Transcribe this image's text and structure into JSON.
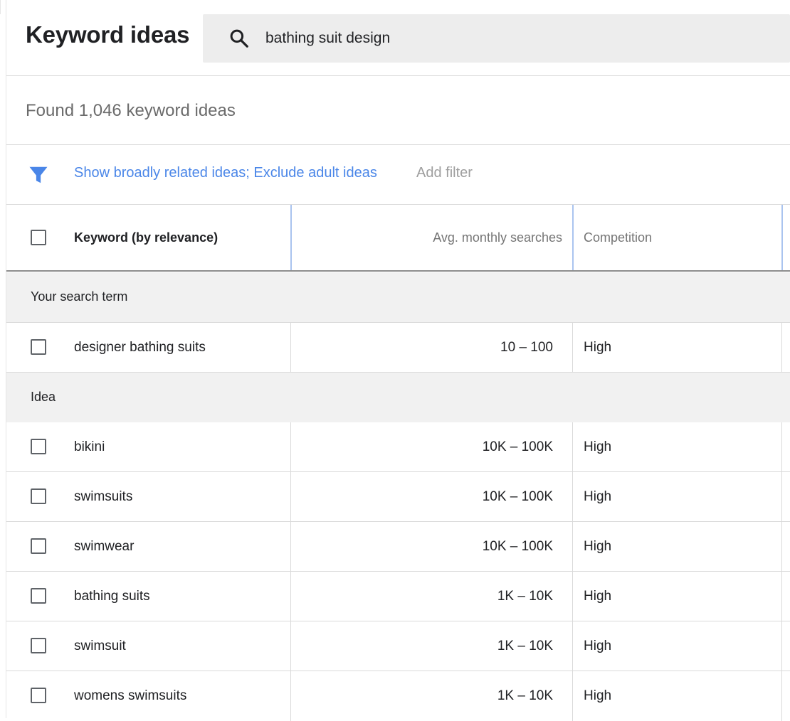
{
  "header": {
    "title": "Keyword ideas",
    "search_value": "bathing suit design"
  },
  "summary": {
    "found_text": "Found 1,046 keyword ideas"
  },
  "filters": {
    "applied_text": "Show broadly related ideas; Exclude adult ideas",
    "add_filter_label": "Add filter",
    "accent_color": "#4a86e8"
  },
  "table": {
    "columns": {
      "keyword": "Keyword (by relevance)",
      "avg_monthly": "Avg. monthly searches",
      "competition": "Competition"
    },
    "search_term_section": "Your search term",
    "search_term_rows": [
      {
        "keyword": "designer bathing suits",
        "avg": "10 – 100",
        "competition": "High"
      }
    ],
    "idea_section": "Idea",
    "idea_rows": [
      {
        "keyword": "bikini",
        "avg": "10K – 100K",
        "competition": "High"
      },
      {
        "keyword": "swimsuits",
        "avg": "10K – 100K",
        "competition": "High"
      },
      {
        "keyword": "swimwear",
        "avg": "10K – 100K",
        "competition": "High"
      },
      {
        "keyword": "bathing suits",
        "avg": "1K – 10K",
        "competition": "High"
      },
      {
        "keyword": "swimsuit",
        "avg": "1K – 10K",
        "competition": "High"
      },
      {
        "keyword": "womens swimsuits",
        "avg": "1K – 10K",
        "competition": "High"
      }
    ]
  },
  "icons": {
    "search": "search-icon",
    "filter": "filter-funnel-icon",
    "checkbox": "checkbox-unchecked"
  }
}
